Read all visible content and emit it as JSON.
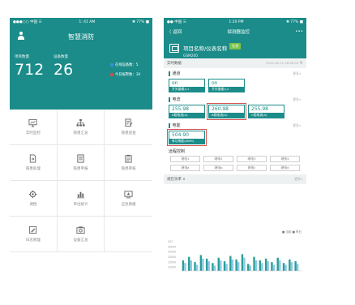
{
  "screen1": {
    "status": {
      "left": "●●●○○ 中国 ☰",
      "time": "1: 41 AM",
      "right": "✱ 77% ■"
    },
    "title": "智慧消防",
    "stats": [
      {
        "label": "项目数量",
        "value": "712"
      },
      {
        "label": "设备数量",
        "value": "26"
      }
    ],
    "legend": [
      {
        "text": "在线设备数：5",
        "color": "#3d8de0"
      },
      {
        "text": "今日报警数：30",
        "color": "#e0483d"
      }
    ],
    "menu": [
      {
        "label": "实时监控",
        "icon": "monitor-icon"
      },
      {
        "label": "隐患汇总",
        "icon": "hierarchy-icon"
      },
      {
        "label": "隐患巡查",
        "icon": "edit-doc-icon"
      },
      {
        "label": "隐患处理",
        "icon": "doc-arrow-icon"
      },
      {
        "label": "隐患申报",
        "icon": "list-doc-icon"
      },
      {
        "label": "隐患审核",
        "icon": "clipboard-icon"
      },
      {
        "label": "调档",
        "icon": "gear-icon"
      },
      {
        "label": "单位统计",
        "icon": "bar-chart-icon"
      },
      {
        "label": "应急救援",
        "icon": "tv-icon"
      },
      {
        "label": "日志管理",
        "icon": "pencil-doc-icon"
      },
      {
        "label": "设备汇总",
        "icon": "camera-icon"
      }
    ]
  },
  "screen2": {
    "status": {
      "left": "●● 中国 ☰",
      "time": "1:20 PM",
      "right": "✱ 77% ■"
    },
    "nav": {
      "back": "〈 返回",
      "title": "探测器监控",
      "more": "•••"
    },
    "device": {
      "name": "项目名称/仪表名称",
      "status": "在线",
      "model": "GSM200"
    },
    "realtime": {
      "label": "实时数据",
      "timestamp": "2019-06-12 08:26:03"
    },
    "more_label": "更多>",
    "sections": [
      {
        "title": "通道",
        "items": [
          {
            "value": "on",
            "label": "开关量输入1",
            "highlight": false
          },
          {
            "value": "on",
            "label": "开关量输入2",
            "highlight": false
          }
        ]
      },
      {
        "title": "电流",
        "items": [
          {
            "value": "255.98",
            "label": "A相电流(A)",
            "highlight": false
          },
          {
            "value": "260.98",
            "label": "B相电流(A)",
            "highlight": true
          },
          {
            "value": "255.98",
            "label": "C相电流(A)",
            "highlight": false
          }
        ]
      },
      {
        "title": "电能",
        "items": [
          {
            "value": "504.90",
            "label": "有功电能(KWH)",
            "highlight": true
          }
        ]
      }
    ],
    "remote": {
      "title": "远程控制",
      "buttons": [
        "继电1",
        "继电2",
        "继电3",
        "继电4",
        "继电a",
        "继电b",
        "继电c",
        "继电d"
      ]
    },
    "chart_head": {
      "label": "视在功率 ∨",
      "more": "更多>"
    }
  },
  "chart_data": {
    "type": "bar",
    "title": "",
    "ylim": [
      0,
      35000
    ],
    "ytick_labels": [
      "347",
      "30000",
      "25000",
      "20000",
      "15000",
      "10000"
    ],
    "series": [
      {
        "name": "当前",
        "color": "#2a9e98",
        "values": [
          12000,
          16000,
          10000,
          18000,
          14000,
          9000,
          15000,
          11000,
          17000,
          13000,
          19000,
          8000,
          16000,
          12000,
          14000,
          10000,
          15000,
          9000,
          13000,
          11000
        ]
      },
      {
        "name": "昨日",
        "color": "#8fc8e8",
        "values": [
          9000,
          12000,
          7000,
          14000,
          11000,
          6000,
          12000,
          8000,
          13000,
          10000,
          15000,
          6000,
          12000,
          9000,
          11000,
          7000,
          12000,
          7000,
          10000,
          8000
        ]
      }
    ],
    "legend_text": "■ 当前  ■ 昨日"
  }
}
